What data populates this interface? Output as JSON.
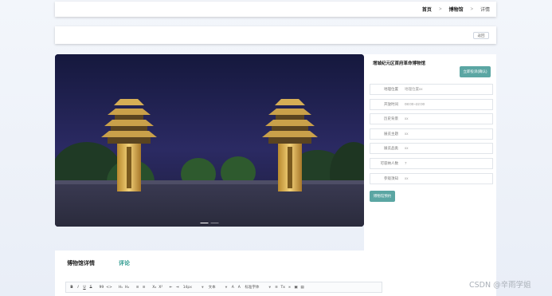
{
  "breadcrumb": {
    "home": "首页",
    "separator": ">",
    "museum": "博物馆",
    "current": "详情"
  },
  "actionbar": {
    "back_label": "返回"
  },
  "hero": {
    "slide_count": 2,
    "active_slide": 0
  },
  "info": {
    "title": "增城纪元区首府革命博物馆",
    "feedback_label": "立即投诉(确认)",
    "fields": [
      {
        "label": "地理位置",
        "value": "地理位置xx"
      },
      {
        "label": "开放时间",
        "value": "08:00~22:00"
      },
      {
        "label": "历史背景",
        "value": "xx"
      },
      {
        "label": "展览主题",
        "value": "xx"
      },
      {
        "label": "展览品类",
        "value": "xx"
      },
      {
        "label": "可容纳人数",
        "value": "7"
      },
      {
        "label": "参观须知",
        "value": "xx"
      }
    ],
    "reserve_label": "博物馆预约"
  },
  "detail": {
    "tab_detail": "博物馆详情",
    "tab_comment": "评论"
  },
  "editor": {
    "bold": "B",
    "italic": "I",
    "underline": "U",
    "strike": "S",
    "quote": "99",
    "code": "<>",
    "h1": "H₁",
    "h2": "H₂",
    "ol": "≡",
    "ul": "≡",
    "sub": "X₂",
    "sup": "X²",
    "outdent": "⇤",
    "indent": "⇥",
    "size": "14px",
    "block": "文本",
    "font": "标准字体",
    "color": "A",
    "bg": "A",
    "align": "≡",
    "clear": "Tx",
    "link": "∞",
    "image": "▣",
    "video": "▤"
  },
  "watermark": "CSDN @辛雨学姐"
}
